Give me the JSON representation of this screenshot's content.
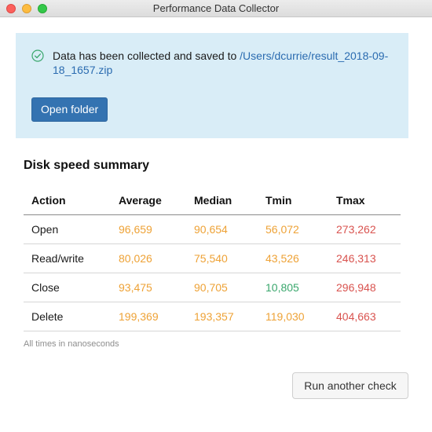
{
  "window": {
    "title": "Performance Data Collector"
  },
  "banner": {
    "message_prefix": "Data has been collected and saved to ",
    "file_path": "/Users/dcurrie/result_2018-09-18_1657.zip",
    "open_folder_label": "Open folder",
    "icon": "check-circle-icon",
    "background_color": "#d9edf7"
  },
  "summary": {
    "title": "Disk speed summary",
    "columns": [
      "Action",
      "Average",
      "Median",
      "Tmin",
      "Tmax"
    ],
    "rows": [
      {
        "action": "Open",
        "average": "96,659",
        "median": "90,654",
        "tmin": "56,072",
        "tmax": "273,262",
        "colors": [
          "orange",
          "orange",
          "orange",
          "red"
        ]
      },
      {
        "action": "Read/write",
        "average": "80,026",
        "median": "75,540",
        "tmin": "43,526",
        "tmax": "246,313",
        "colors": [
          "orange",
          "orange",
          "orange",
          "red"
        ]
      },
      {
        "action": "Close",
        "average": "93,475",
        "median": "90,705",
        "tmin": "10,805",
        "tmax": "296,948",
        "colors": [
          "orange",
          "orange",
          "green",
          "red"
        ]
      },
      {
        "action": "Delete",
        "average": "199,369",
        "median": "193,357",
        "tmin": "119,030",
        "tmax": "404,663",
        "colors": [
          "orange",
          "orange",
          "orange",
          "red"
        ]
      }
    ],
    "footnote": "All times in nanoseconds"
  },
  "actions": {
    "run_again_label": "Run another check"
  },
  "colors": {
    "orange": "#eea236",
    "red": "#d9534f",
    "green": "#3aa76d",
    "link": "#2a6bb0",
    "primary_button": "#3473b1"
  }
}
